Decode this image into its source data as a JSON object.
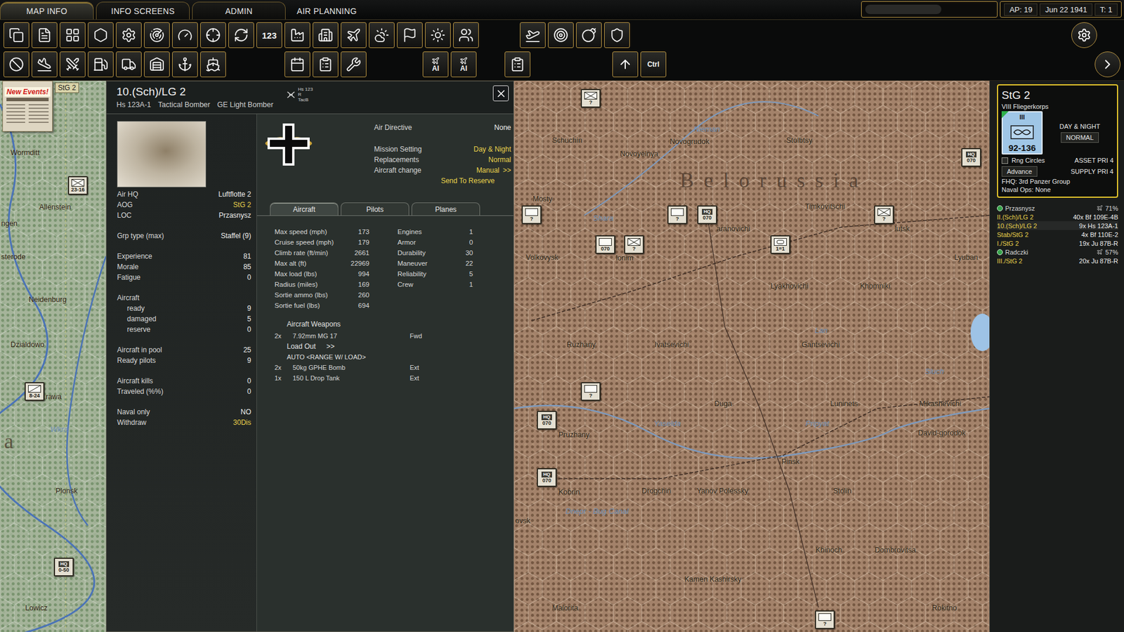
{
  "top_bar": {
    "tabs": [
      {
        "label": "MAP INFO",
        "selected": true
      },
      {
        "label": "INFO SCREENS",
        "selected": false
      },
      {
        "label": "ADMIN",
        "selected": false
      },
      {
        "label": "AIR PLANNING",
        "selected": false
      }
    ],
    "status": {
      "ap": "AP: 19",
      "date": "Jun 22 1941",
      "turn": "T: 1"
    }
  },
  "toolbar": {
    "counter_label": "123",
    "ai_labels": [
      "AI",
      "AI"
    ],
    "ctrl_label": "Ctrl"
  },
  "events": {
    "label": "New Events!"
  },
  "selection_tag": "StG 2",
  "unit_panel": {
    "title": "10.(Sch)/LG 2",
    "subtitle": [
      "Hs 123A-1",
      "Tactical Bomber",
      "GE Light Bomber"
    ],
    "type_badge": [
      "Hs 123",
      "R",
      "TacB"
    ],
    "info_sections": [
      [
        {
          "kind": "row",
          "label": "Air HQ",
          "value": "Luftflotte 2",
          "highlight": false
        },
        {
          "kind": "row",
          "label": "AOG",
          "value": "StG 2",
          "highlight": true
        },
        {
          "kind": "row",
          "label": "LOC",
          "value": "Przasnysz",
          "highlight": false
        }
      ],
      [
        {
          "kind": "row",
          "label": "Grp type (max)",
          "value": "Staffel (9)",
          "highlight": false
        }
      ],
      [
        {
          "kind": "row",
          "label": "Experience",
          "value": "81",
          "highlight": false
        },
        {
          "kind": "row",
          "label": "Morale",
          "value": "85",
          "highlight": false
        },
        {
          "kind": "row",
          "label": "Fatigue",
          "value": "0",
          "highlight": false
        }
      ],
      [
        {
          "kind": "heading",
          "label": "Aircraft",
          "value": "",
          "highlight": false
        },
        {
          "kind": "sub",
          "label": "ready",
          "value": "9",
          "highlight": false
        },
        {
          "kind": "sub",
          "label": "damaged",
          "value": "5",
          "highlight": false
        },
        {
          "kind": "sub",
          "label": "reserve",
          "value": "0",
          "highlight": false
        }
      ],
      [
        {
          "kind": "row",
          "label": "Aircraft in pool",
          "value": "25",
          "highlight": false
        },
        {
          "kind": "row",
          "label": "Ready pilots",
          "value": "9",
          "highlight": false
        }
      ],
      [
        {
          "kind": "row",
          "label": "Aircraft kills",
          "value": "0",
          "highlight": false
        },
        {
          "kind": "row",
          "label": "Traveled (%%)",
          "value": "0",
          "highlight": false
        }
      ],
      [
        {
          "kind": "row",
          "label": "Naval only",
          "value": "NO",
          "highlight": false
        },
        {
          "kind": "row",
          "label": "Withdraw",
          "value": "30Dis",
          "highlight": true
        }
      ]
    ],
    "settings": [
      {
        "label": "Air Directive",
        "value": "None",
        "highlight": false,
        "arrow": ""
      },
      {
        "label": "Mission Setting",
        "value": "Day & Night",
        "highlight": true,
        "arrow": ""
      },
      {
        "label": "Replacements",
        "value": "Normal",
        "highlight": true,
        "arrow": ""
      },
      {
        "label": "Aircraft change",
        "value": "Manual",
        "highlight": true,
        "arrow": ">>"
      }
    ],
    "send_to_reserve": "Send To Reserve",
    "tabs": [
      {
        "label": "Aircraft",
        "selected": true
      },
      {
        "label": "Pilots",
        "selected": false
      },
      {
        "label": "Planes",
        "selected": false
      }
    ],
    "stats_left": [
      {
        "label": "Max speed (mph)",
        "value": "173"
      },
      {
        "label": "Cruise speed (mph)",
        "value": "179"
      },
      {
        "label": "Climb rate (ft/min)",
        "value": "2661"
      },
      {
        "label": "Max alt (ft)",
        "value": "22969"
      },
      {
        "label": "Max load (lbs)",
        "value": "994"
      },
      {
        "label": "Radius (miles)",
        "value": "169"
      },
      {
        "label": "Sortie ammo (lbs)",
        "value": "260"
      },
      {
        "label": "Sortie fuel (lbs)",
        "value": "694"
      }
    ],
    "stats_right": [
      {
        "label": "Engines",
        "value": "1"
      },
      {
        "label": "Armor",
        "value": "0"
      },
      {
        "label": "Durability",
        "value": "30"
      },
      {
        "label": "Maneuver",
        "value": "22"
      },
      {
        "label": "Reliability",
        "value": "5"
      },
      {
        "label": "Crew",
        "value": "1"
      }
    ],
    "weapons": {
      "title": "Aircraft Weapons",
      "guns": [
        {
          "count": "2x",
          "name": "7.92mm MG 17",
          "mount": "Fwd"
        }
      ],
      "load_out": {
        "label": "Load Out",
        "arrow": ">>",
        "mode": "AUTO <RANGE W/ LOAD>"
      },
      "loads": [
        {
          "count": "2x",
          "name": "50kg GPHE Bomb",
          "mount": "Ext"
        },
        {
          "count": "1x",
          "name": "150 L Drop Tank",
          "mount": "Ext"
        }
      ]
    }
  },
  "air_group": {
    "name": "StG 2",
    "corps": "VIII Fliegerkorps",
    "size": "III",
    "strength": "92-136",
    "mission": "DAY & NIGHT",
    "replacements": "NORMAL",
    "range_circles": {
      "label": "Rng Circles",
      "checked": false
    },
    "asset_priority": "ASSET PRI 4",
    "advance": "Advance",
    "supply_priority": "SUPPLY PRI 4",
    "fhq": "FHQ: 3rd Panzer Group",
    "naval_ops": "Naval Ops: None",
    "list": [
      {
        "kind": "base",
        "name": "Przasnysz",
        "value": "71%",
        "selected": false
      },
      {
        "kind": "unit",
        "name": "II.(Sch)/LG 2",
        "value": "40x Bf 109E-4B",
        "selected": false
      },
      {
        "kind": "unit",
        "name": "10.(Sch)/LG 2",
        "value": "9x Hs 123A-1",
        "selected": true
      },
      {
        "kind": "unit",
        "name": "Stab/StG 2",
        "value": "4x Bf 110E-2",
        "selected": false
      },
      {
        "kind": "unit",
        "name": "I./StG 2",
        "value": "19x Ju 87B-R",
        "selected": false
      },
      {
        "kind": "base",
        "name": "Radczki",
        "value": "57%",
        "selected": false
      },
      {
        "kind": "unit",
        "name": "III./StG 2",
        "value": "20x Ju 87B-R",
        "selected": false
      }
    ]
  },
  "map": {
    "left_labels": [
      {
        "text": "Wormditt",
        "kind": "town"
      },
      {
        "text": "Allenstein",
        "kind": "town"
      },
      {
        "text": "ngen",
        "kind": "town"
      },
      {
        "text": "sterode",
        "kind": "town"
      },
      {
        "text": "Neidenburg",
        "kind": "town"
      },
      {
        "text": "Dzialdowo",
        "kind": "town"
      },
      {
        "text": "rawa",
        "kind": "town"
      },
      {
        "text": "Wkra",
        "kind": "river"
      },
      {
        "text": "a",
        "kind": "region"
      },
      {
        "text": "Plonsk",
        "kind": "town"
      },
      {
        "text": "Lowicz",
        "kind": "town"
      }
    ],
    "left_counters": [
      {
        "kind": "infantry",
        "top": "",
        "bottom": "23-16"
      },
      {
        "kind": "motorized",
        "top": "",
        "bottom": "8-24"
      },
      {
        "kind": "hq",
        "top": "HQ",
        "bottom": "0-50"
      }
    ],
    "labels": [
      {
        "text": "Schuchin",
        "kind": "town"
      },
      {
        "text": "Novogrudok",
        "kind": "town"
      },
      {
        "text": "Nieman",
        "kind": "river"
      },
      {
        "text": "Stolbtsy",
        "kind": "town"
      },
      {
        "text": "Belorussia",
        "kind": "region"
      },
      {
        "text": "Novoyelnya",
        "kind": "town"
      },
      {
        "text": "Mosty",
        "kind": "town"
      },
      {
        "text": "Shara",
        "kind": "river"
      },
      {
        "text": "aranovichi",
        "kind": "town"
      },
      {
        "text": "Timkovitschi",
        "kind": "town"
      },
      {
        "text": "lutsk",
        "kind": "town"
      },
      {
        "text": "Volkovysk",
        "kind": "town"
      },
      {
        "text": "lonim",
        "kind": "town"
      },
      {
        "text": "Lyakhovichi",
        "kind": "town"
      },
      {
        "text": "Khomniki",
        "kind": "town"
      },
      {
        "text": "Lyuban",
        "kind": "town"
      },
      {
        "text": "Lan",
        "kind": "river"
      },
      {
        "text": "Gantsevichi",
        "kind": "town"
      },
      {
        "text": "Ruzhany",
        "kind": "town"
      },
      {
        "text": "Ivatsevichi",
        "kind": "town"
      },
      {
        "text": "Sluch",
        "kind": "river"
      },
      {
        "text": "Duga",
        "kind": "town"
      },
      {
        "text": "Luninets",
        "kind": "town"
      },
      {
        "text": "Mikashevichi",
        "kind": "town"
      },
      {
        "text": "Yaselda",
        "kind": "river"
      },
      {
        "text": "Pruzhany",
        "kind": "town"
      },
      {
        "text": "Pripyat",
        "kind": "river"
      },
      {
        "text": "David-gorodok",
        "kind": "town"
      },
      {
        "text": "Pinsk",
        "kind": "town"
      },
      {
        "text": "Kobrin",
        "kind": "town"
      },
      {
        "text": "Drogchin",
        "kind": "town"
      },
      {
        "text": "Yanov Polessky",
        "kind": "town"
      },
      {
        "text": "Stolin",
        "kind": "town"
      },
      {
        "text": "Dnepr - Bug Canal",
        "kind": "river"
      },
      {
        "text": "Khinoch",
        "kind": "town"
      },
      {
        "text": "Dombrovitsa",
        "kind": "town"
      },
      {
        "text": "Kamen Kashirsky",
        "kind": "town"
      },
      {
        "text": "Malorita",
        "kind": "town"
      },
      {
        "text": "Rokitno",
        "kind": "town"
      },
      {
        "text": "ovsk",
        "kind": "town"
      }
    ],
    "counters": [
      {
        "kind": "air",
        "top": "",
        "bottom": "?"
      },
      {
        "kind": "unit",
        "top": "",
        "bottom": "?"
      },
      {
        "kind": "unit",
        "top": "",
        "bottom": "?"
      },
      {
        "kind": "hq",
        "top": "HQ",
        "bottom": "070"
      },
      {
        "kind": "air",
        "top": "",
        "bottom": "?"
      },
      {
        "kind": "unit",
        "top": "",
        "bottom": "070"
      },
      {
        "kind": "air",
        "top": "",
        "bottom": "?"
      },
      {
        "kind": "armor",
        "top": "",
        "bottom": "1=1"
      },
      {
        "kind": "unit",
        "top": "",
        "bottom": "?"
      },
      {
        "kind": "hq",
        "top": "HQ",
        "bottom": "070"
      },
      {
        "kind": "hq",
        "top": "HQ",
        "bottom": "070"
      },
      {
        "kind": "hq",
        "top": "HQ",
        "bottom": "070"
      },
      {
        "kind": "unit",
        "top": "",
        "bottom": "?"
      }
    ]
  }
}
